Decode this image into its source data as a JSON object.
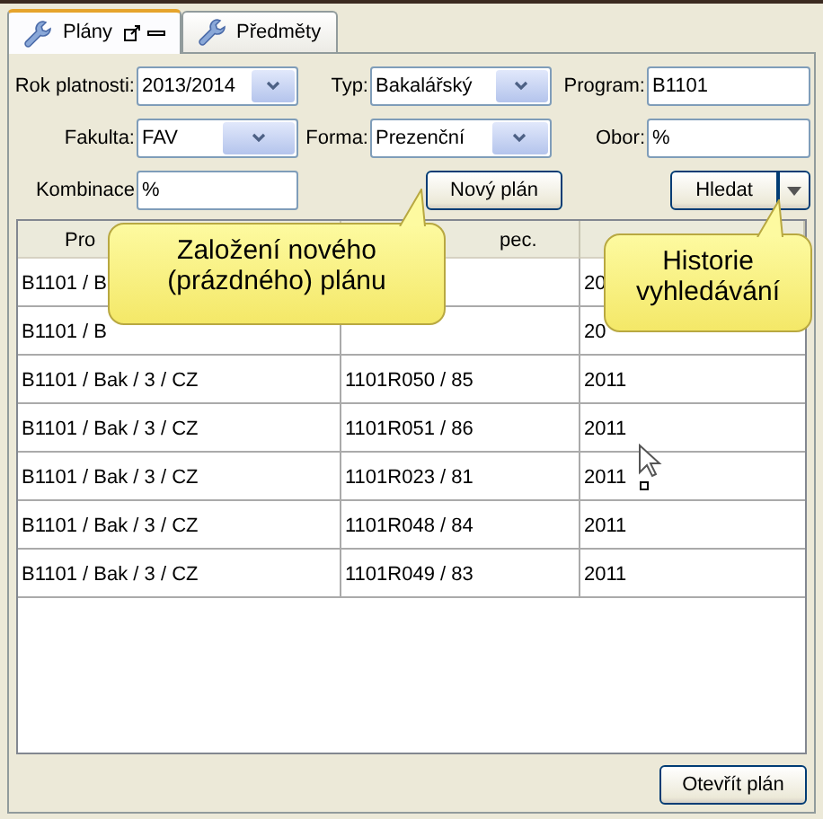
{
  "tabs": [
    {
      "label": "Plány",
      "selected": true,
      "window_controls": true
    },
    {
      "label": "Předměty",
      "selected": false,
      "window_controls": false
    }
  ],
  "form": {
    "rows": [
      [
        {
          "label": "Rok platnosti:",
          "value": "2013/2014",
          "kind": "select"
        },
        {
          "label": "Typ:",
          "value": "Bakalářský",
          "kind": "select"
        },
        {
          "label": "Program:",
          "value": "B1101",
          "kind": "text"
        }
      ],
      [
        {
          "label": "Fakulta:",
          "value": "FAV",
          "kind": "select"
        },
        {
          "label": "Forma:",
          "value": "Prezenční",
          "kind": "select"
        },
        {
          "label": "Obor:",
          "value": "%",
          "kind": "text"
        }
      ]
    ],
    "combination": {
      "label": "Kombinace",
      "value": "%"
    },
    "new_button": "Nový plán",
    "search_button": "Hledat"
  },
  "table": {
    "columns": [
      "Pro",
      "pec."
    ],
    "rows": [
      [
        "B1101 / B",
        "",
        "20"
      ],
      [
        "B1101 / B",
        "",
        "20"
      ],
      [
        "B1101 / Bak / 3 / CZ",
        "1101R050 / 85",
        "2011"
      ],
      [
        "B1101 / Bak / 3 / CZ",
        "1101R051 / 86",
        "2011"
      ],
      [
        "B1101 / Bak / 3 / CZ",
        "1101R023 / 81",
        "2011"
      ],
      [
        "B1101 / Bak / 3 / CZ",
        "1101R048 / 84",
        "2011"
      ],
      [
        "B1101 / Bak / 3 / CZ",
        "1101R049 / 83",
        "2011"
      ]
    ]
  },
  "callouts": [
    {
      "text": "Založení nového\n(prázdného) plánu"
    },
    {
      "text": "Historie\nvyhledávání"
    }
  ],
  "open_button": "Otevřít plán"
}
